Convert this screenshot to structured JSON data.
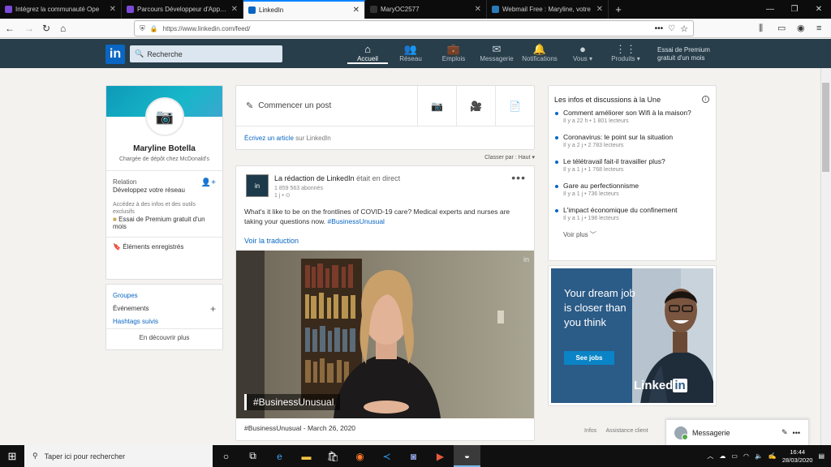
{
  "browser": {
    "tabs": [
      {
        "label": "Intégrez la communauté Ope",
        "favcolor": "#7b4ad8",
        "active": false
      },
      {
        "label": "Parcours Développeur d'Applicatio",
        "favcolor": "#7b4ad8",
        "active": false
      },
      {
        "label": "LinkedIn",
        "favcolor": "#0a66c2",
        "active": true
      },
      {
        "label": "MaryOC2577",
        "favcolor": "#333333",
        "active": false
      },
      {
        "label": "Webmail Free : Maryline, votre",
        "favcolor": "#2a7ab8",
        "active": false
      }
    ],
    "url": "https://www.linkedin.com/feed/"
  },
  "linkedin": {
    "search_placeholder": "Recherche",
    "nav": [
      {
        "label": "Accueil",
        "icon": "home-icon",
        "glyph": "⌂"
      },
      {
        "label": "Réseau",
        "icon": "network-icon",
        "glyph": "👥"
      },
      {
        "label": "Emplois",
        "icon": "briefcase-icon",
        "glyph": "💼"
      },
      {
        "label": "Messagerie",
        "icon": "chat-icon",
        "glyph": "✉"
      },
      {
        "label": "Notifications",
        "icon": "bell-icon",
        "glyph": "🔔"
      },
      {
        "label": "Vous ▾",
        "icon": "avatar-icon",
        "glyph": "●"
      },
      {
        "label": "Produits ▾",
        "icon": "grid-icon",
        "glyph": "⋮⋮"
      }
    ],
    "premium": "Essai de Premium gratuit d'un mois"
  },
  "profile": {
    "name": "Maryline Botella",
    "title": "Chargée de dépôt chez McDonald's",
    "relation_label": "Relation",
    "relation_sub": "Développez votre réseau",
    "premium_intro": "Accédez à des infos et des outils exclusifs",
    "premium_link": "Essai de Premium gratuit d'un mois",
    "saved": "Éléments enregistrés"
  },
  "groups": {
    "groupes": "Groupes",
    "evenements": "Événements",
    "hashtags": "Hashtags suivis",
    "discover": "En découvrir plus"
  },
  "share": {
    "post": "Commencer un post",
    "article_link": "Écrivez un article",
    "article_rest": " sur LinkedIn"
  },
  "sort": "Classer par : Haut",
  "post": {
    "author": "La rédaction de LinkedIn",
    "status": " était en direct",
    "followers": "1 859 563 abonnés",
    "time": "1 j • ⊙",
    "text": "What's it like to be on the frontlines of COVID-19 care? Medical experts and nurses are taking your questions now. ",
    "hashtag": "#BusinessUnusual",
    "translate": "Voir la traduction",
    "video_tag": "#BusinessUnusual",
    "caption": "#BusinessUnusual - March 26, 2020"
  },
  "news": {
    "title": "Les infos et discussions à la Une",
    "items": [
      {
        "title": "Comment améliorer son Wifi à la maison?",
        "meta": "Il y a 22 h • 1 801 lecteurs"
      },
      {
        "title": "Coronavirus: le point sur la situation",
        "meta": "Il y a 2 j • 2 783 lecteurs"
      },
      {
        "title": "Le télétravail fait-il travailler plus?",
        "meta": "Il y a 1 j • 1 768 lecteurs"
      },
      {
        "title": "Gare au perfectionnisme",
        "meta": "Il y a 1 j • 736 lecteurs"
      },
      {
        "title": "L'impact économique du confinement",
        "meta": "Il y a 1 j • 198 lecteurs"
      }
    ],
    "more": "Voir plus ﹀"
  },
  "ad": {
    "headline": "Your dream job is closer than you think",
    "button": "See jobs",
    "brand": "Linked",
    "brand_in": "in"
  },
  "footer": {
    "info": "Infos",
    "assist": "Assistance client"
  },
  "messaging": {
    "label": "Messagerie"
  },
  "taskbar": {
    "search": "Taper ici pour rechercher",
    "time": "16:44",
    "date": "28/03/2020"
  }
}
